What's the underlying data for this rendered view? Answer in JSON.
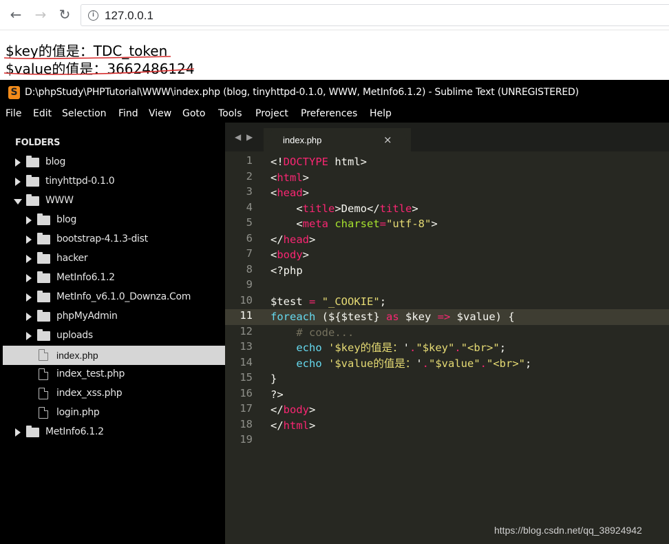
{
  "browser": {
    "back_icon": "arrow-left-icon",
    "forward_icon": "arrow-right-icon",
    "reload_icon": "reload-icon",
    "info_icon": "info-circle-icon",
    "url": "127.0.0.1"
  },
  "page_output": {
    "line1": "$key的值是：TDC_token",
    "line2": "$value的值是：3662486124",
    "underline_color": "#d62c2c"
  },
  "sublime": {
    "logo_text": "S",
    "title": "D:\\phpStudy\\PHPTutorial\\WWW\\index.php (blog, tinyhttpd-0.1.0, WWW, MetInfo6.1.2) - Sublime Text (UNREGISTERED)",
    "menu": [
      "File",
      "Edit",
      "Selection",
      "Find",
      "View",
      "Goto",
      "Tools",
      "Project",
      "Preferences",
      "Help"
    ],
    "sidebar": {
      "heading": "FOLDERS",
      "items": [
        {
          "label": "blog",
          "type": "folder",
          "expanded": false
        },
        {
          "label": "tinyhttpd-0.1.0",
          "type": "folder",
          "expanded": false
        },
        {
          "label": "WWW",
          "type": "folder",
          "expanded": true
        },
        {
          "label": "blog",
          "type": "folder",
          "expanded": false
        },
        {
          "label": "bootstrap-4.1.3-dist",
          "type": "folder",
          "expanded": false
        },
        {
          "label": "hacker",
          "type": "folder",
          "expanded": false
        },
        {
          "label": "MetInfo6.1.2",
          "type": "folder",
          "expanded": false
        },
        {
          "label": "MetInfo_v6.1.0_Downza.Com",
          "type": "folder",
          "expanded": false
        },
        {
          "label": "phpMyAdmin",
          "type": "folder",
          "expanded": false
        },
        {
          "label": "uploads",
          "type": "folder",
          "expanded": false
        },
        {
          "label": "index.php",
          "type": "file",
          "selected": true
        },
        {
          "label": "index_test.php",
          "type": "file"
        },
        {
          "label": "index_xss.php",
          "type": "file"
        },
        {
          "label": "login.php",
          "type": "file"
        },
        {
          "label": "MetInfo6.1.2",
          "type": "folder",
          "expanded": false
        }
      ]
    },
    "tab_nav": "◀ ▶",
    "tab": {
      "label": "index.php",
      "close": "×"
    },
    "current_line": 11,
    "line_numbers": [
      "1",
      "2",
      "3",
      "4",
      "5",
      "6",
      "7",
      "8",
      "9",
      "10",
      "11",
      "12",
      "13",
      "14",
      "15",
      "16",
      "17",
      "18",
      "19"
    ],
    "code_lines": [
      [
        [
          "w",
          "<!"
        ],
        [
          "p",
          "DOCTYPE"
        ],
        [
          "w",
          " html>"
        ]
      ],
      [
        [
          "w",
          "<"
        ],
        [
          "p",
          "html"
        ],
        [
          "w",
          ">"
        ]
      ],
      [
        [
          "w",
          "<"
        ],
        [
          "p",
          "head"
        ],
        [
          "w",
          ">"
        ]
      ],
      [
        [
          "w",
          "    <"
        ],
        [
          "p",
          "title"
        ],
        [
          "w",
          ">Demo</"
        ],
        [
          "p",
          "title"
        ],
        [
          "w",
          ">"
        ]
      ],
      [
        [
          "w",
          "    <"
        ],
        [
          "p",
          "meta"
        ],
        [
          "w",
          " "
        ],
        [
          "g",
          "charset"
        ],
        [
          "p",
          "="
        ],
        [
          "y",
          "\"utf-8\""
        ],
        [
          "w",
          ">"
        ]
      ],
      [
        [
          "w",
          "</"
        ],
        [
          "p",
          "head"
        ],
        [
          "w",
          ">"
        ]
      ],
      [
        [
          "w",
          "<"
        ],
        [
          "p",
          "body"
        ],
        [
          "w",
          ">"
        ]
      ],
      [
        [
          "w",
          "<?php"
        ]
      ],
      [
        [
          "w",
          ""
        ]
      ],
      [
        [
          "w",
          "$test "
        ],
        [
          "p",
          "="
        ],
        [
          "w",
          " "
        ],
        [
          "y",
          "\"_COOKIE\""
        ],
        [
          "w",
          ";"
        ]
      ],
      [
        [
          "b",
          "foreach"
        ],
        [
          "w",
          " (${$test} "
        ],
        [
          "p",
          "as"
        ],
        [
          "w",
          " $key "
        ],
        [
          "p",
          "=>"
        ],
        [
          "w",
          " $value) {"
        ]
      ],
      [
        [
          "w",
          "    "
        ],
        [
          "c",
          "# code..."
        ]
      ],
      [
        [
          "w",
          "    "
        ],
        [
          "b",
          "echo"
        ],
        [
          "w",
          " "
        ],
        [
          "y",
          "'$key的值是："
        ],
        [
          "w",
          "'"
        ],
        [
          "p",
          "."
        ],
        [
          "y",
          "\"$key\""
        ],
        [
          "p",
          "."
        ],
        [
          "y",
          "\"<br>\""
        ],
        [
          "w",
          ";"
        ]
      ],
      [
        [
          "w",
          "    "
        ],
        [
          "b",
          "echo"
        ],
        [
          "w",
          " "
        ],
        [
          "y",
          "'$value的值是："
        ],
        [
          "w",
          "'"
        ],
        [
          "p",
          "."
        ],
        [
          "y",
          "\"$value\""
        ],
        [
          "p",
          "."
        ],
        [
          "y",
          "\"<br>\""
        ],
        [
          "w",
          ";"
        ]
      ],
      [
        [
          "w",
          "}"
        ]
      ],
      [
        [
          "w",
          "?>"
        ]
      ],
      [
        [
          "w",
          "</"
        ],
        [
          "p",
          "body"
        ],
        [
          "w",
          ">"
        ]
      ],
      [
        [
          "w",
          "</"
        ],
        [
          "p",
          "html"
        ],
        [
          "w",
          ">"
        ]
      ],
      [
        [
          "w",
          ""
        ]
      ]
    ],
    "colors": {
      "editor_bg": "#272822",
      "keyword_pink": "#f92672",
      "attr_green": "#a6e22e",
      "string_yellow": "#e6db74",
      "keyword_blue": "#66d9ef",
      "comment_gray": "#75715e"
    }
  },
  "watermark": "https://blog.csdn.net/qq_38924942"
}
